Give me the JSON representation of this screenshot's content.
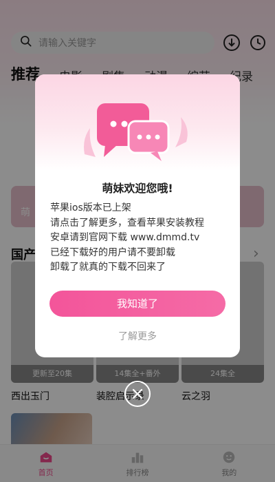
{
  "search": {
    "placeholder": "请输入关键字"
  },
  "top_icons": {
    "download": "download-icon",
    "history": "clock-icon"
  },
  "tabs": [
    {
      "label": "推荐",
      "active": true
    },
    {
      "label": "电影"
    },
    {
      "label": "剧集"
    },
    {
      "label": "动漫"
    },
    {
      "label": "综艺"
    },
    {
      "label": "纪录"
    }
  ],
  "banner": {
    "partial_text": "萌"
  },
  "section": {
    "title": "国产",
    "arrow": "›"
  },
  "cards": [
    {
      "badge": "更新至20集",
      "title": "西出玉门"
    },
    {
      "badge": "14集全+番外",
      "title": "装腔启示录"
    },
    {
      "badge": "24集全",
      "title": "云之羽"
    }
  ],
  "bottom_nav": [
    {
      "label": "首页",
      "icon": "home-icon",
      "active": true
    },
    {
      "label": "排行榜",
      "icon": "ranking-icon"
    },
    {
      "label": "我的",
      "icon": "profile-icon"
    }
  ],
  "dialog": {
    "title": "萌妹欢迎您哦!",
    "lines": [
      "苹果ios版本已上架",
      "请点击了解更多，查看苹果安装教程",
      "安卓请到官网下载 www.dmmd.tv",
      "已经下载好的用户请不要卸载",
      "卸载了就真的下载不回来了"
    ],
    "primary_button": "我知道了",
    "secondary_link": "了解更多",
    "illustration_icon": "chat-bubbles-icon"
  },
  "close_icon": "close-icon",
  "colors": {
    "accent": "#f3559a",
    "overlay": "rgba(0,0,0,0.45)"
  }
}
